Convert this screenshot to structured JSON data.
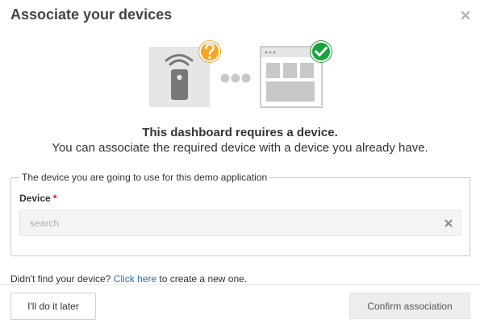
{
  "dialog": {
    "title": "Associate your devices",
    "close_icon": "close-icon"
  },
  "illustration": {
    "remote_icon": "remote-control-icon",
    "question_badge": "?",
    "question_badge_color": "#f5a623",
    "connector_icon": "connecting-dots-icon",
    "dashboard_icon": "dashboard-icon",
    "check_badge_color": "#1aa33a"
  },
  "message": {
    "headline": "This dashboard requires a device.",
    "subline": "You can associate the required device with a device you already have."
  },
  "form": {
    "legend": "The device you are going to use for this demo application",
    "device_label": "Device",
    "required_marker": "*",
    "search_placeholder": "search",
    "search_value": ""
  },
  "footer": {
    "note_prefix": "Didn't find your device?",
    "link_text": "Click here",
    "note_suffix": "to create a new one.",
    "later_button": "I'll do it later",
    "confirm_button": "Confirm association"
  },
  "colors": {
    "link": "#1f6fb2",
    "required": "#cc1f1f",
    "icon_gray": "#7a7a7a",
    "tile_gray": "#e6e6e6"
  }
}
